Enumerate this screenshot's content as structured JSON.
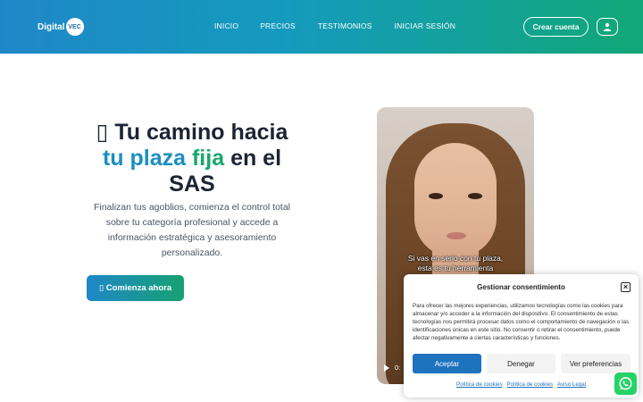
{
  "header": {
    "logo_text": "Digital",
    "logo_badge": "VEC",
    "nav": [
      "INICIO",
      "PRECIOS",
      "TESTIMONIOS",
      "INICIAR SESIÓN"
    ],
    "cta": "Crear cuenta",
    "gradient_start": "#1f87c8",
    "gradient_end": "#12a777"
  },
  "hero": {
    "title_icon": "▯",
    "title_part1": "Tu camino hacia",
    "title_highlight_a": "tu plaza",
    "title_highlight_b": "fija",
    "title_part2": "en el",
    "title_part3": "SAS",
    "description": "Finalizan tus agoblios, comienza el control total sobre tu categoría profesional y accede a información estratégica y asesoramiento personalizado.",
    "button_icon": "▯",
    "button_label": "Comienza ahora"
  },
  "video": {
    "caption_line1": "Si vas en serio con tu plaza,",
    "caption_line2": "esta es tu herramienta",
    "time": "0:"
  },
  "cookie": {
    "title": "Gestionar consentimiento",
    "close": "×",
    "text": "Para ofrecer las mejores experiencias, utilizamos tecnologías como las cookies para almacenar y/o acceder a la información del dispositivo. El consentimiento de estas tecnologías nos permitirá procesar datos como el comportamiento de navegación o las identificaciones únicas en este sitio. No consentir o retirar el consentimiento, puede afectar negativamente a ciertas características y funciones.",
    "accept": "Aceptar",
    "deny": "Denegar",
    "prefs": "Ver preferencias",
    "links": [
      "Política de cookies",
      "Política de cookies",
      "Aviso Legal"
    ]
  },
  "icons": {
    "user": "user-icon",
    "whatsapp": "whatsapp-icon",
    "play": "play-icon"
  }
}
